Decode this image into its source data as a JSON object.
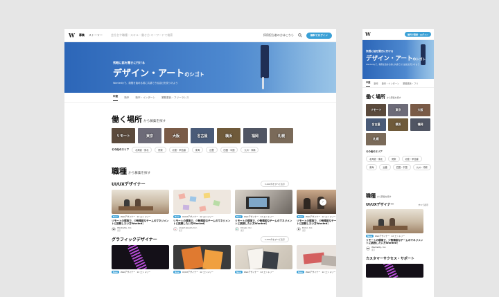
{
  "header": {
    "logo": "W",
    "nav_active": "募集",
    "nav_story": "ストーリー",
    "search_placeholder": "会社名や職種・スキル・働き方 キーワードで検索",
    "link_company": "採用担当者の方はこちら",
    "cta": "無料でログイン",
    "cta_mobile": "無料で登録・ログイン"
  },
  "hero": {
    "small": "気軽に話を聞きに行ける",
    "big": "デザイン・アート",
    "big_suffix": "のシゴト",
    "sub": "Wantedlyで、制限を始める前に共感できる会社を見つけよう"
  },
  "tabs": [
    "中途",
    "新卒",
    "新卒・インターン",
    "業務委託・フリーランス"
  ],
  "tabs_mobile": [
    "中途",
    "新卒",
    "新卒・インターン",
    "業務委託・フリ"
  ],
  "work_place": {
    "title": "働く場所",
    "suffix": "から募集を探す",
    "tiles": [
      {
        "label": "リモート",
        "color": "#5b4a3c"
      },
      {
        "label": "東京",
        "color": "#6d6b78"
      },
      {
        "label": "大阪",
        "color": "#7a5b47"
      },
      {
        "label": "名古屋",
        "color": "#4a5b78"
      },
      {
        "label": "横浜",
        "color": "#6f5a3a"
      },
      {
        "label": "福岡",
        "color": "#505563"
      },
      {
        "label": "札幌",
        "color": "#7a6a59"
      }
    ],
    "other_label": "その他のエリア",
    "areas": [
      "北海道・東北",
      "関東",
      "北陸・甲信越",
      "東海",
      "近畿",
      "四国・中国",
      "九州・沖縄"
    ]
  },
  "job_type": {
    "title": "職種",
    "suffix": "から募集を探す"
  },
  "uiux": {
    "title": "UI/UXデザイナー",
    "more": "3,000件をすべて表示",
    "more_mobile": "すべて表示",
    "cards": [
      {
        "badge": "New",
        "role": "Webデザイナー",
        "count": "12 エントリー",
        "title": "リモートの環境で、少数精鋭なチームのマネジメントに挑戦したい方Wanted！",
        "company": "Wantedly, Inc.",
        "loc": "東京",
        "avatar": "W",
        "img": "#c9b9a3"
      },
      {
        "badge": "New",
        "role": "UI/UXデザイナー",
        "count": "12 エントリー",
        "title": "リモートの環境で、少数精鋭なチームのマネジメントに挑戦したい方Wanted！",
        "company": "Lorem Ipsum, Inc.",
        "loc": "東京",
        "avatar": "L",
        "img": "#e8ddd3"
      },
      {
        "badge": "New",
        "role": "Webデザイナー",
        "count": "12 エントリー",
        "title": "リモートの環境で、少数精鋭なチームのマネジメントに挑戦したい方Wanted！",
        "company": "Clover, Inc.",
        "loc": "東京",
        "avatar": "C",
        "img": "#a9a39c"
      },
      {
        "badge": "New",
        "role": "Webデザイナー",
        "count": "12 エントリー",
        "title": "リモートの環境で、少数精鋭なチームのマネジメントに挑戦したい方Wanted！",
        "company": "Dolor, Inc.",
        "loc": "東京",
        "avatar": "D",
        "img": "#8b6f5a"
      }
    ]
  },
  "graphic": {
    "title": "グラフィックデザイナー",
    "more": "3,000件をすべて表示",
    "cards": [
      {
        "badge": "New",
        "role": "Webデザイナー",
        "count": "12 エントリー",
        "img": "#1a1320"
      },
      {
        "badge": "New",
        "role": "UI/UXデザイナー",
        "count": "12 エントリー",
        "img": "#e07a30"
      },
      {
        "badge": "New",
        "role": "Webデザイナー",
        "count": "12 エントリー",
        "img": "#c7bfb2"
      },
      {
        "badge": "New",
        "role": "Webデザイナー",
        "count": "12 エントリー",
        "img": "#d9cfc8"
      }
    ]
  },
  "mobile": {
    "cs_title": "カスタマーサクセス・サポート"
  }
}
